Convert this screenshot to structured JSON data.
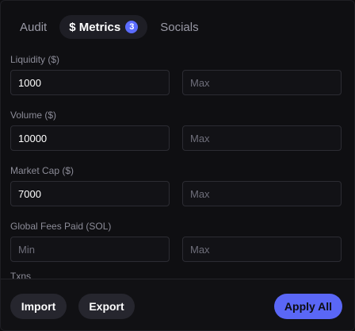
{
  "tabs": [
    {
      "label": "Audit"
    },
    {
      "label": "$ Metrics",
      "badge": "3"
    },
    {
      "label": "Socials"
    }
  ],
  "filters": [
    {
      "label": "Liquidity ($)",
      "min_value": "1000",
      "min_placeholder": "",
      "max_value": "",
      "max_placeholder": "Max"
    },
    {
      "label": "Volume ($)",
      "min_value": "10000",
      "min_placeholder": "",
      "max_value": "",
      "max_placeholder": "Max"
    },
    {
      "label": "Market Cap ($)",
      "min_value": "7000",
      "min_placeholder": "",
      "max_value": "",
      "max_placeholder": "Max"
    },
    {
      "label": "Global Fees Paid (SOL)",
      "min_value": "",
      "min_placeholder": "Min",
      "max_value": "",
      "max_placeholder": "Max"
    }
  ],
  "partial_label": "Txns",
  "footer": {
    "import_label": "Import",
    "export_label": "Export",
    "apply_label": "Apply All"
  },
  "colors": {
    "accent": "#5a67f6",
    "badge": "#5b6cff"
  }
}
